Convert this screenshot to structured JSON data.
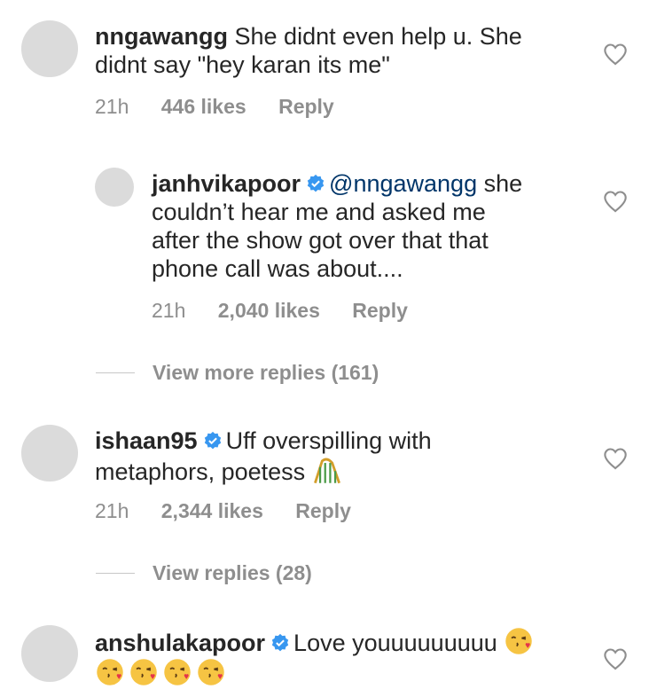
{
  "comments": [
    {
      "username": "nngawangg",
      "text": "She didnt even help u. She didnt say \"hey karan its me\"",
      "text_line1": "She didnt even help u. She",
      "text_line2": "didnt say \"hey karan its me\"",
      "time": "21h",
      "likes": "446 likes",
      "reply": "Reply"
    },
    {
      "username": "janhvikapoor",
      "verified": true,
      "mention": "@nngawangg",
      "text_line1": "she",
      "text_line2": "couldn’t hear me and asked me",
      "text_line3": "after the show got over that that",
      "text_line4": "phone call was about....",
      "time": "21h",
      "likes": "2,040 likes",
      "reply": "Reply"
    },
    {
      "view_replies": "View more replies (161)"
    },
    {
      "username": "ishaan95",
      "verified": true,
      "text_line1": "Uff overspilling with",
      "text_line2": "metaphors, poetess",
      "emoji": "roller-coaster",
      "time": "21h",
      "likes": "2,344 likes",
      "reply": "Reply"
    },
    {
      "view_replies": "View replies (28)"
    },
    {
      "username": "anshulakapoor",
      "verified": true,
      "text_line1": "Love youuuuuuuuu",
      "emoji": "face-blowing-a-kiss",
      "emoji_count_line2": 4
    }
  ],
  "colors": {
    "text": "#262626",
    "meta": "#8e8e8e",
    "mention": "#003569",
    "verified": "#3897f0",
    "avatar": "#dbdbdb"
  },
  "icons": [
    "heart-outline-icon",
    "verified-badge-icon"
  ]
}
